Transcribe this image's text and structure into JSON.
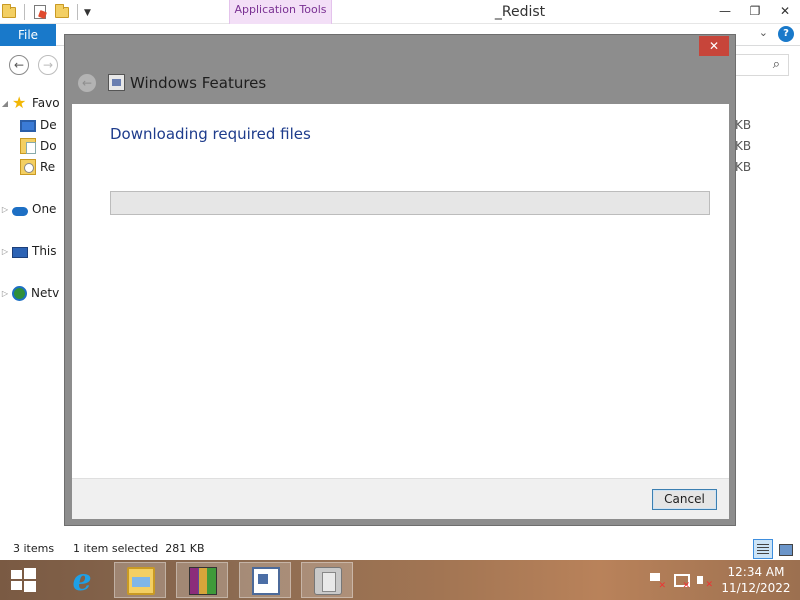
{
  "explorer": {
    "context_tab": "Application Tools",
    "title": "_Redist",
    "caption_buttons": {
      "minimize": "—",
      "maximize": "❐",
      "close": "✕"
    },
    "ribbon": {
      "file_tab": "File",
      "collapse_glyph": "⌄",
      "help_glyph": "?"
    },
    "nav": {
      "back_glyph": "←",
      "forward_glyph": "→",
      "search_glyph": "⌕"
    },
    "nav_pane": [
      {
        "label": "Favo",
        "icon": "star-icon"
      },
      {
        "label": "De",
        "icon": "desktop-icon"
      },
      {
        "label": "Do",
        "icon": "documents-icon"
      },
      {
        "label": "Re",
        "icon": "recent-places-icon"
      },
      {
        "label": "One",
        "icon": "onedrive-icon"
      },
      {
        "label": "This",
        "icon": "this-pc-icon"
      },
      {
        "label": "Netv",
        "icon": "network-icon"
      }
    ],
    "size_column": [
      "KB",
      "KB",
      "KB"
    ],
    "status": {
      "items": "3 items",
      "selection": "1 item selected  281 KB"
    }
  },
  "dialog": {
    "title": "Windows Features",
    "heading": "Downloading required files",
    "progress": 0,
    "cancel_label": "Cancel",
    "close_glyph": "✕",
    "back_glyph": "←"
  },
  "taskbar": {
    "apps": [
      {
        "name": "Internet Explorer",
        "icon": "internet-explorer-icon",
        "active": false
      },
      {
        "name": "File Explorer",
        "icon": "file-explorer-icon",
        "active": true
      },
      {
        "name": "WinRAR",
        "icon": "winrar-icon",
        "active": false
      },
      {
        "name": "Windows Features",
        "icon": "windows-features-icon",
        "active": true
      },
      {
        "name": "Setup",
        "icon": "setup-icon",
        "active": true
      }
    ],
    "clock": {
      "time": "12:34 AM",
      "date": "11/12/2022"
    },
    "ie_glyph": "e"
  },
  "colors": {
    "accent": "#1979ca",
    "dialog_frame": "#8d8d8d",
    "heading_blue": "#1e3c8c",
    "close_red": "#c7453a",
    "context_tab": "#f3dff7"
  }
}
